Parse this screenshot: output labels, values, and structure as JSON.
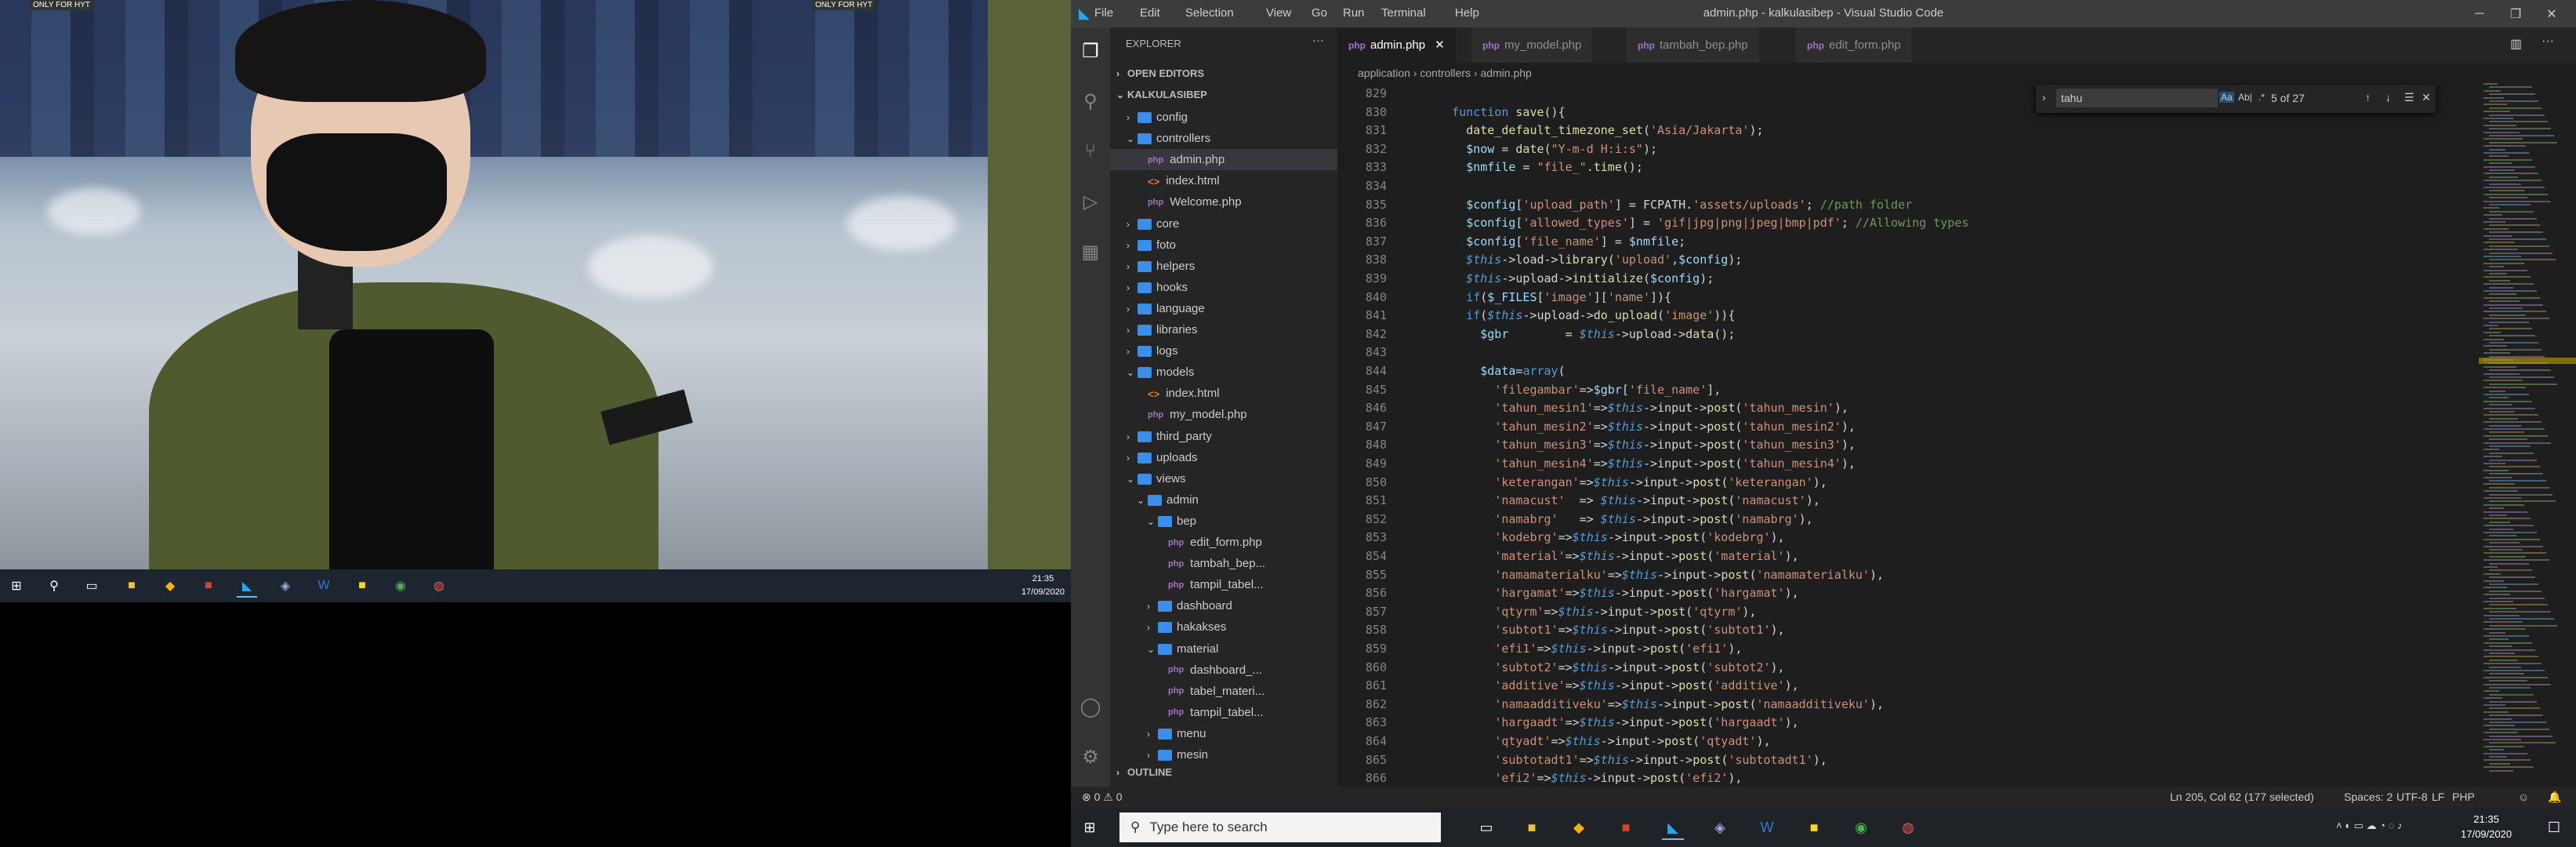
{
  "left_screen": {
    "wallpaper_label": "ONLY FOR HYT",
    "clock_time": "21:35",
    "clock_date": "17/09/2020",
    "taskbar_icons": [
      "windows-start-icon",
      "search-icon",
      "task-view-icon",
      "file-explorer-icon",
      "app-icon",
      "ppt-icon",
      "vscode-icon",
      "app-icon-2",
      "word-icon",
      "sticky-notes-icon",
      "chrome-icon",
      "app-icon-3"
    ]
  },
  "window": {
    "title": "admin.php - kalkulasibep - Visual Studio Code",
    "menu": [
      "File",
      "Edit",
      "Selection",
      "View",
      "Go",
      "Run",
      "Terminal",
      "Help"
    ]
  },
  "explorer": {
    "header": "EXPLORER",
    "open_editors": "OPEN EDITORS",
    "project": "KALKULASIBEP",
    "outline": "OUTLINE",
    "tree": [
      {
        "label": "config",
        "type": "folder",
        "open": false,
        "depth": 1
      },
      {
        "label": "controllers",
        "type": "folder",
        "open": true,
        "depth": 1
      },
      {
        "label": "admin.php",
        "type": "php",
        "depth": 2,
        "selected": true
      },
      {
        "label": "index.html",
        "type": "html",
        "depth": 2
      },
      {
        "label": "Welcome.php",
        "type": "php",
        "depth": 2
      },
      {
        "label": "core",
        "type": "folder",
        "open": false,
        "depth": 1
      },
      {
        "label": "foto",
        "type": "folder",
        "open": false,
        "depth": 1
      },
      {
        "label": "helpers",
        "type": "folder",
        "open": false,
        "depth": 1
      },
      {
        "label": "hooks",
        "type": "folder",
        "open": false,
        "depth": 1
      },
      {
        "label": "language",
        "type": "folder",
        "open": false,
        "depth": 1
      },
      {
        "label": "libraries",
        "type": "folder",
        "open": false,
        "depth": 1
      },
      {
        "label": "logs",
        "type": "folder",
        "open": false,
        "depth": 1
      },
      {
        "label": "models",
        "type": "folder",
        "open": true,
        "depth": 1
      },
      {
        "label": "index.html",
        "type": "html",
        "depth": 2
      },
      {
        "label": "my_model.php",
        "type": "php",
        "depth": 2
      },
      {
        "label": "third_party",
        "type": "folder",
        "open": false,
        "depth": 1
      },
      {
        "label": "uploads",
        "type": "folder",
        "open": false,
        "depth": 1
      },
      {
        "label": "views",
        "type": "folder",
        "open": true,
        "depth": 1
      },
      {
        "label": "admin",
        "type": "folder",
        "open": true,
        "depth": 2
      },
      {
        "label": "bep",
        "type": "folder",
        "open": true,
        "depth": 3
      },
      {
        "label": "edit_form.php",
        "type": "php",
        "depth": 4
      },
      {
        "label": "tambah_bep...",
        "type": "php",
        "depth": 4
      },
      {
        "label": "tampil_tabel...",
        "type": "php",
        "depth": 4
      },
      {
        "label": "dashboard",
        "type": "folder",
        "open": false,
        "depth": 3
      },
      {
        "label": "hakakses",
        "type": "folder",
        "open": false,
        "depth": 3
      },
      {
        "label": "material",
        "type": "folder",
        "open": true,
        "depth": 3
      },
      {
        "label": "dashboard_...",
        "type": "php",
        "depth": 4
      },
      {
        "label": "tabel_materi...",
        "type": "php",
        "depth": 4
      },
      {
        "label": "tampil_tabel...",
        "type": "php",
        "depth": 4
      },
      {
        "label": "menu",
        "type": "folder",
        "open": false,
        "depth": 3
      },
      {
        "label": "mesin",
        "type": "folder",
        "open": false,
        "depth": 3
      }
    ]
  },
  "tabs": [
    {
      "label": "admin.php",
      "active": true
    },
    {
      "label": "my_model.php",
      "active": false
    },
    {
      "label": "tambah_bep.php",
      "active": false
    },
    {
      "label": "edit_form.php",
      "active": false
    }
  ],
  "breadcrumb": [
    "application",
    "controllers",
    "admin.php"
  ],
  "find": {
    "query": "tahu",
    "count": "5 of 27",
    "opt_case": "Aa",
    "opt_word": "Ab|",
    "opt_regex": ".*"
  },
  "code_lines": [
    {
      "n": "829",
      "t": ""
    },
    {
      "n": "830",
      "t": "    function save(){"
    },
    {
      "n": "831",
      "t": "      date_default_timezone_set('Asia/Jakarta');"
    },
    {
      "n": "832",
      "t": "      $now = date(\"Y-m-d H:i:s\");"
    },
    {
      "n": "833",
      "t": "      $nmfile = \"file_\".time();"
    },
    {
      "n": "834",
      "t": ""
    },
    {
      "n": "835",
      "t": "      $config['upload_path'] = FCPATH.'assets/uploads'; //path folder"
    },
    {
      "n": "836",
      "t": "      $config['allowed_types'] = 'gif|jpg|png|jpeg|bmp|pdf'; //Allowing types"
    },
    {
      "n": "837",
      "t": "      $config['file_name'] = $nmfile;"
    },
    {
      "n": "838",
      "t": "      $this->load->library('upload',$config);"
    },
    {
      "n": "839",
      "t": "      $this->upload->initialize($config);"
    },
    {
      "n": "840",
      "t": "      if($_FILES['image']['name']){"
    },
    {
      "n": "841",
      "t": "      if($this->upload->do_upload('image')){"
    },
    {
      "n": "842",
      "t": "        $gbr        = $this->upload->data();"
    },
    {
      "n": "843",
      "t": ""
    },
    {
      "n": "844",
      "t": "        $data=array("
    },
    {
      "n": "845",
      "t": "          'filegambar'=>$gbr['file_name'],"
    },
    {
      "n": "846",
      "t": "          'tahun_mesin1'=>$this->input->post('tahun_mesin'),"
    },
    {
      "n": "847",
      "t": "          'tahun_mesin2'=>$this->input->post('tahun_mesin2'),"
    },
    {
      "n": "848",
      "t": "          'tahun_mesin3'=>$this->input->post('tahun_mesin3'),"
    },
    {
      "n": "849",
      "t": "          'tahun_mesin4'=>$this->input->post('tahun_mesin4'),"
    },
    {
      "n": "850",
      "t": "          'keterangan'=>$this->input->post('keterangan'),"
    },
    {
      "n": "851",
      "t": "          'namacust'  => $this->input->post('namacust'),"
    },
    {
      "n": "852",
      "t": "          'namabrg'   => $this->input->post('namabrg'),"
    },
    {
      "n": "853",
      "t": "          'kodebrg'=>$this->input->post('kodebrg'),"
    },
    {
      "n": "854",
      "t": "          'material'=>$this->input->post('material'),"
    },
    {
      "n": "855",
      "t": "          'namamaterialku'=>$this->input->post('namamaterialku'),"
    },
    {
      "n": "856",
      "t": "          'hargamat'=>$this->input->post('hargamat'),"
    },
    {
      "n": "857",
      "t": "          'qtyrm'=>$this->input->post('qtyrm'),"
    },
    {
      "n": "858",
      "t": "          'subtot1'=>$this->input->post('subtot1'),"
    },
    {
      "n": "859",
      "t": "          'efi1'=>$this->input->post('efi1'),"
    },
    {
      "n": "860",
      "t": "          'subtot2'=>$this->input->post('subtot2'),"
    },
    {
      "n": "861",
      "t": "          'additive'=>$this->input->post('additive'),"
    },
    {
      "n": "862",
      "t": "          'namaadditiveku'=>$this->input->post('namaadditiveku'),"
    },
    {
      "n": "863",
      "t": "          'hargaadt'=>$this->input->post('hargaadt'),"
    },
    {
      "n": "864",
      "t": "          'qtyadt'=>$this->input->post('qtyadt'),"
    },
    {
      "n": "865",
      "t": "          'subtotadt1'=>$this->input->post('subtotadt1'),"
    },
    {
      "n": "866",
      "t": "          'efi2'=>$this->input->post('efi2'),"
    }
  ],
  "status": {
    "errors": "0",
    "warnings": "0",
    "position": "Ln 205, Col 62 (177 selected)",
    "spaces": "Spaces: 2",
    "encoding": "UTF-8",
    "eol": "LF",
    "language": "PHP"
  },
  "taskbar": {
    "search_placeholder": "Type here to search",
    "clock_time": "21:35",
    "clock_date": "17/09/2020"
  },
  "colors": {
    "accent": "#007acc",
    "folder": "#3b8eea",
    "php": "#a074c4",
    "html": "#e37933"
  }
}
